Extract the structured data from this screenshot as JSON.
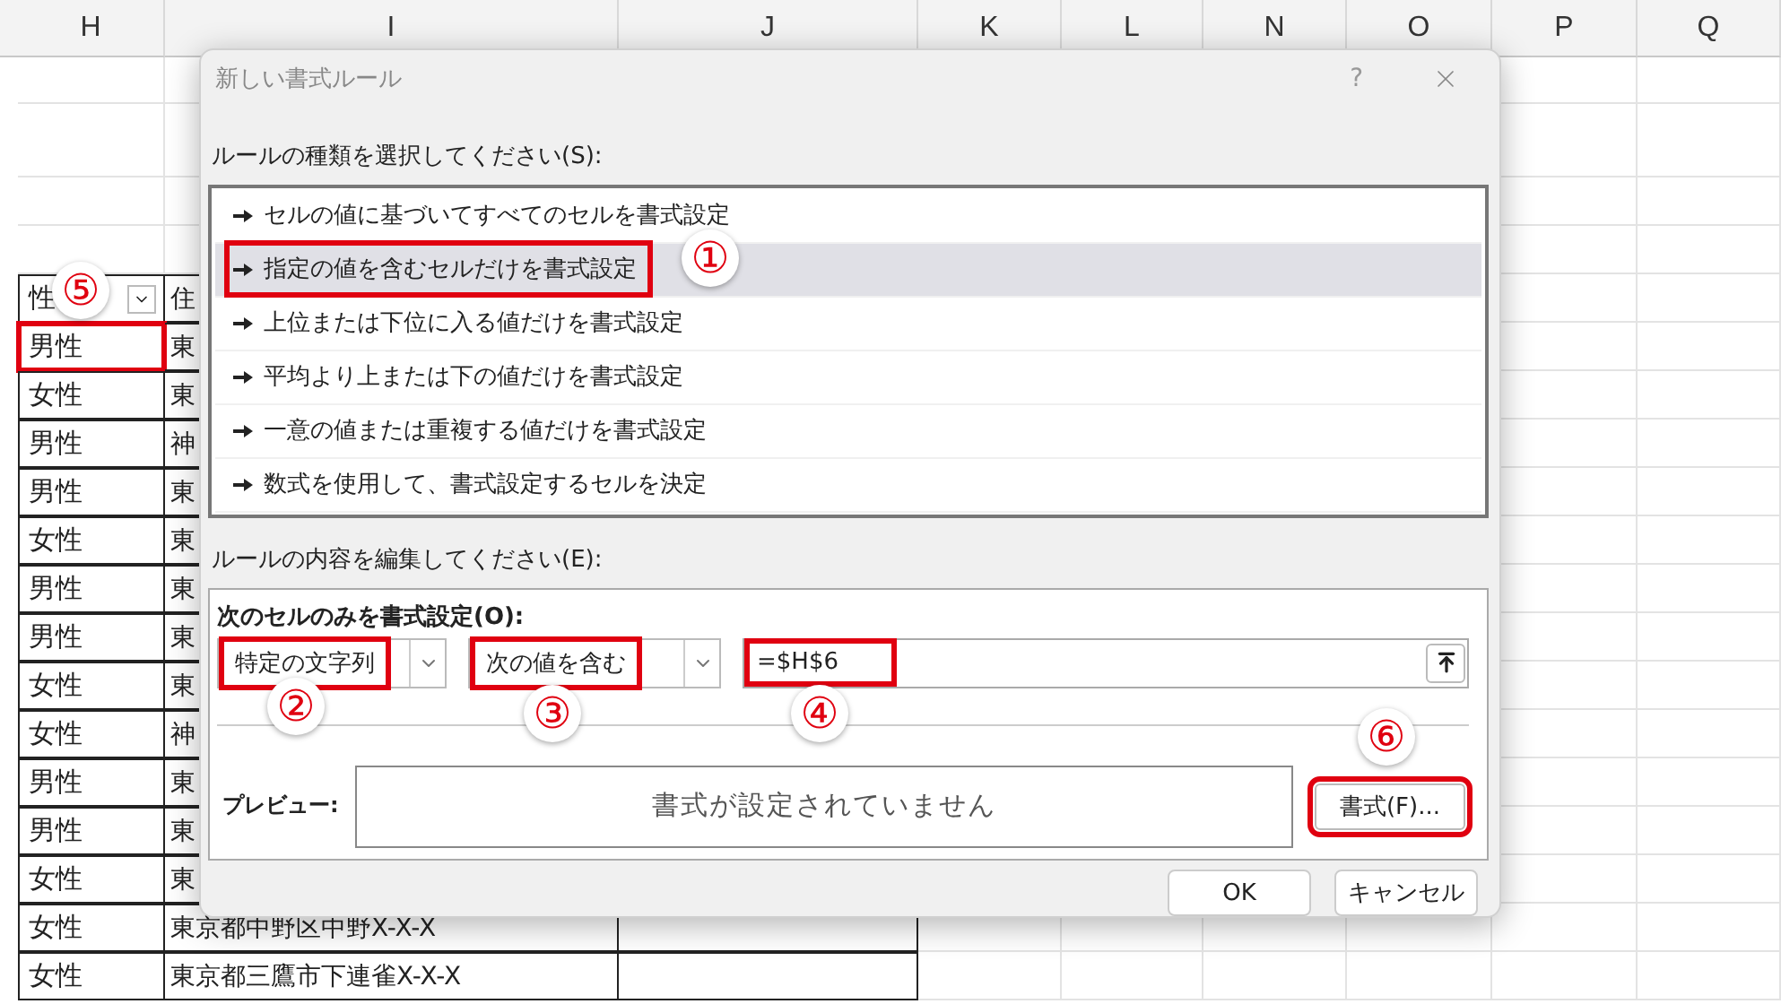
{
  "sheet": {
    "columns": [
      "H",
      "I",
      "J",
      "K",
      "L",
      "N",
      "O",
      "P",
      "Q"
    ],
    "header_row": {
      "col_h": "性",
      "col_i": "住"
    },
    "rows": [
      {
        "col_h": "男性",
        "col_i": "東"
      },
      {
        "col_h": "女性",
        "col_i": "東"
      },
      {
        "col_h": "男性",
        "col_i": "神"
      },
      {
        "col_h": "男性",
        "col_i": "東"
      },
      {
        "col_h": "女性",
        "col_i": "東"
      },
      {
        "col_h": "男性",
        "col_i": "東"
      },
      {
        "col_h": "男性",
        "col_i": "東"
      },
      {
        "col_h": "女性",
        "col_i": "東"
      },
      {
        "col_h": "女性",
        "col_i": "神"
      },
      {
        "col_h": "男性",
        "col_i": "東"
      },
      {
        "col_h": "男性",
        "col_i": "東"
      },
      {
        "col_h": "女性",
        "col_i": "東"
      },
      {
        "col_h": "女性",
        "col_i": "東京都中野区中野X-X-X"
      },
      {
        "col_h": "女性",
        "col_i": "東京都三鷹市下連雀X-X-X"
      }
    ]
  },
  "dialog": {
    "title": "新しい書式ルール",
    "help": "?",
    "rule_type_label": "ルールの種類を選択してください(S):",
    "rule_types": [
      {
        "label": "セルの値に基づいてすべてのセルを書式設定",
        "selected": false
      },
      {
        "label": "指定の値を含むセルだけを書式設定",
        "selected": true
      },
      {
        "label": "上位または下位に入る値だけを書式設定",
        "selected": false
      },
      {
        "label": "平均より上または下の値だけを書式設定",
        "selected": false
      },
      {
        "label": "一意の値または重複する値だけを書式設定",
        "selected": false
      },
      {
        "label": "数式を使用して、書式設定するセルを決定",
        "selected": false
      }
    ],
    "edit_label": "ルールの内容を編集してください(E):",
    "condition_label": "次のセルのみを書式設定(O):",
    "type_dropdown": "特定の文字列",
    "operator_dropdown": "次の値を含む",
    "value_field": "=$H$6",
    "preview_label": "プレビュー:",
    "preview_text": "書式が設定されていません",
    "format_button": "書式(F)...",
    "buttons": [
      "OK",
      "キャンセル"
    ]
  },
  "annotations": [
    "⑤",
    "①",
    "②",
    "③",
    "④",
    "⑥"
  ]
}
